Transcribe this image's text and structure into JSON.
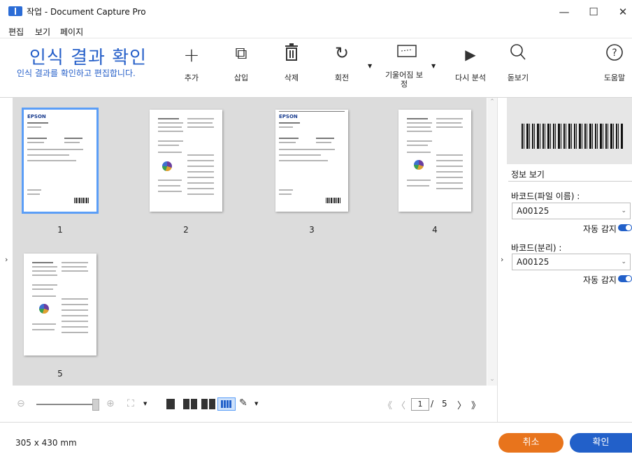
{
  "window": {
    "title": "작업 - Document Capture Pro",
    "minimize": "—",
    "maximize": "☐",
    "close": "✕"
  },
  "menu": [
    "편집",
    "보기",
    "페이지"
  ],
  "header": {
    "title": "인식 결과 확인",
    "subtitle": "인식 결과를 확인하고 편집합니다."
  },
  "toolbar": {
    "add": {
      "label": "추가",
      "icon": "plus-icon",
      "glyph": "+"
    },
    "insert": {
      "label": "삽입",
      "icon": "insert-page-icon",
      "glyph": "⧉"
    },
    "delete": {
      "label": "삭제",
      "icon": "trash-icon",
      "glyph": "🗑"
    },
    "rotate": {
      "label": "회전",
      "icon": "rotate-icon",
      "glyph": "↻"
    },
    "deskew": {
      "label_line1": "기울어짐 보",
      "label_line2": "정",
      "icon": "deskew-icon",
      "glyph": "▭"
    },
    "reanalyze": {
      "label": "다시 분석",
      "icon": "play-icon",
      "glyph": "▶"
    },
    "zoom": {
      "label": "돋보기",
      "icon": "magnifier-icon",
      "glyph": "⌕"
    },
    "help": {
      "label": "도움말",
      "icon": "help-icon",
      "glyph": "?"
    }
  },
  "pages": [
    {
      "number": "1",
      "logo": "EPSON"
    },
    {
      "number": "2",
      "logo": ""
    },
    {
      "number": "3",
      "logo": "EPSON"
    },
    {
      "number": "4",
      "logo": ""
    },
    {
      "number": "5",
      "logo": ""
    }
  ],
  "pagination": {
    "current": "1",
    "separator": "/",
    "total": "5",
    "first": "《",
    "prev": "〈",
    "next": "〉",
    "last": "》"
  },
  "status": {
    "page_size": "305 x 430 mm"
  },
  "buttons": {
    "cancel": "취소",
    "ok": "확인"
  },
  "info_panel": {
    "title": "정보 보기",
    "barcode_filename_label": "바코드(파일 이름) :",
    "barcode_filename_value": "A00125",
    "barcode_split_label": "바코드(분리) :",
    "barcode_split_value": "A00125",
    "auto_detect_label": "자동 감지",
    "auto_detect_1": true,
    "auto_detect_2": true
  },
  "colors": {
    "accent": "#2760c9",
    "cancel": "#e8741c",
    "ok": "#2260c9"
  }
}
